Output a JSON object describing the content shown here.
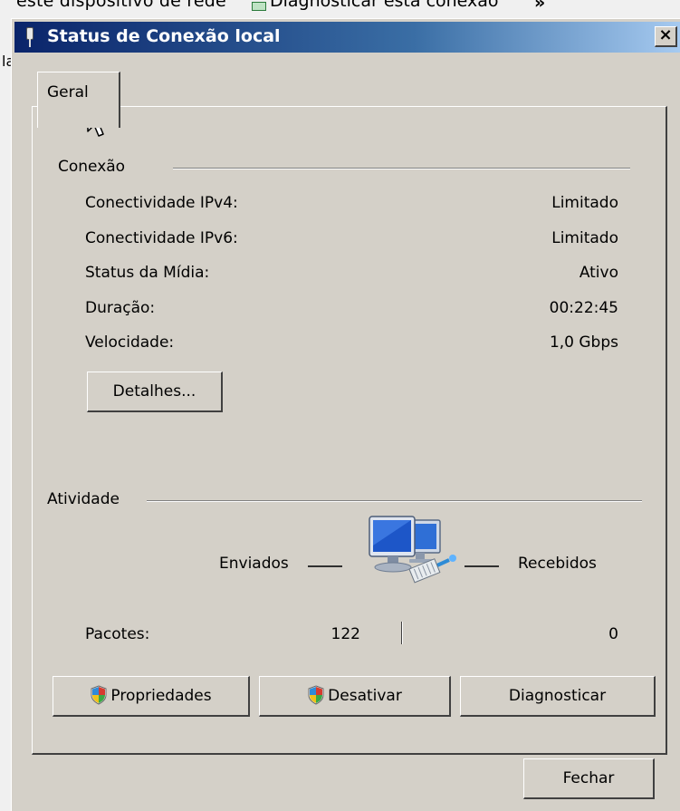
{
  "background": {
    "text_left": "este dispositivo de rede",
    "text_right": "Diagnosticar esta conexão",
    "more_chevron": "»",
    "left_edge_char": "la"
  },
  "window": {
    "title": "Status de Conexão local",
    "close_glyph": "×"
  },
  "tabs": [
    {
      "label": "Geral",
      "selected": true
    }
  ],
  "connection": {
    "group_title": "Conexão",
    "rows": [
      {
        "label": "Conectividade IPv4:",
        "value": "Limitado"
      },
      {
        "label": "Conectividade IPv6:",
        "value": "Limitado"
      },
      {
        "label": "Status da Mídia:",
        "value": "Ativo"
      },
      {
        "label": "Duração:",
        "value": "00:22:45"
      },
      {
        "label": "Velocidade:",
        "value": "1,0 Gbps"
      }
    ],
    "details_button": "Detalhes..."
  },
  "activity": {
    "group_title": "Atividade",
    "sent_label": "Enviados",
    "received_label": "Recebidos",
    "packets_label": "Pacotes:",
    "packets_sent": "122",
    "packets_received": "0",
    "icon": "network-computers-icon"
  },
  "buttons": {
    "properties": "Propriedades",
    "disable": "Desativar",
    "diagnose": "Diagnosticar",
    "close": "Fechar"
  },
  "colors": {
    "title_start": "#0a246a",
    "title_end": "#a6caf0",
    "dialog_bg": "#d4d0c8"
  }
}
